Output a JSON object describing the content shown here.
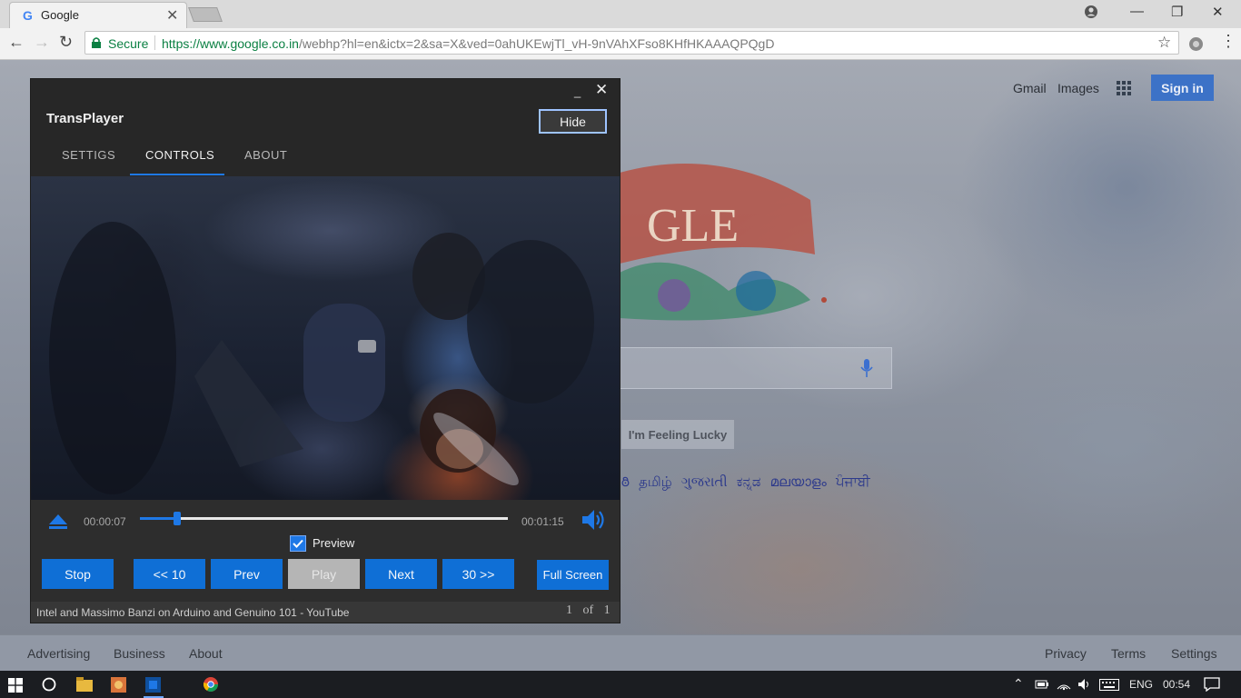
{
  "browser": {
    "tab_title": "Google",
    "tab_favicon": "G",
    "secure_label": "Secure",
    "url_host": "https://www.google.co.in",
    "url_rest": "/webhp?hl=en&ictx=2&sa=X&ved=0ahUKEwjTl_vH-9nVAhXFso8KHfHKAAAQPQgD"
  },
  "google": {
    "gmail": "Gmail",
    "images": "Images",
    "signin": "Sign in",
    "lucky": "I'm Feeling Lucky",
    "languages": "ఠి தமிழ் ગુજરાતી ಕನ್ನಡ മലയാളം ਪੰਜਾਬੀ",
    "doodle_text": "GLE",
    "footer": {
      "advertising": "Advertising",
      "business": "Business",
      "about": "About",
      "privacy": "Privacy",
      "terms": "Terms",
      "settings": "Settings"
    }
  },
  "player": {
    "title": "TransPlayer",
    "hide": "Hide",
    "tabs": [
      "SETTIGS",
      "CONTROLS",
      "ABOUT"
    ],
    "active_tab": "CONTROLS",
    "current_time": "00:00:07",
    "total_time": "00:01:15",
    "progress": 0.1,
    "preview_label": "Preview",
    "preview_checked": true,
    "buttons": {
      "stop": "Stop",
      "back10": "<< 10",
      "prev": "Prev",
      "play": "Play",
      "next": "Next",
      "fwd30": "30 >>",
      "fullscreen": "Full Screen"
    },
    "now_playing": "Intel and Massimo Banzi on Arduino and Genuino 101 - YouTube",
    "counter": "1 of 1",
    "accent": "#1e78e6"
  },
  "taskbar": {
    "lang": "ENG",
    "time": "00:54"
  }
}
